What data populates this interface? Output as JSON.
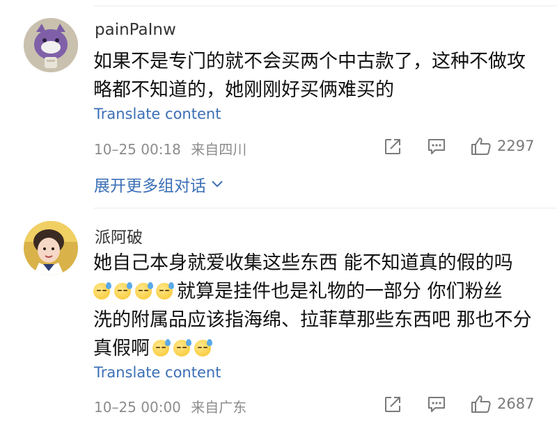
{
  "comments": [
    {
      "username": "painPaInw",
      "avatar": "purple-cartoon-avatar",
      "text": "如果不是专门的就不会买两个中古款了，这种不做攻略都不知道的，她刚刚好买俩难买的",
      "translate_label": "Translate content",
      "timestamp": "10–25 00:18",
      "location": "来自四川",
      "likes": "2297",
      "expand_label": "展开更多组对话"
    },
    {
      "username": "派阿破",
      "avatar": "child-photo-avatar",
      "text_line1": "她自己本身就爱收集这些东西 能不知道真的假的吗",
      "text_line2": "就算是挂件也是礼物的一部分 你们粉丝",
      "text_line3": "洗的附属品应该指海绵、拉菲草那些东西吧 那也不分",
      "text_line4": "真假啊",
      "emoji_name": "sweat-emoji",
      "translate_label": "Translate content",
      "timestamp": "10–25 00:00",
      "location": "来自广东",
      "likes": "2687"
    }
  ],
  "icons": {
    "share": "share-icon",
    "comment": "comment-icon",
    "like": "thumbs-up-icon"
  },
  "colors": {
    "link": "#3b6fb6",
    "meta": "#8c8c8c"
  }
}
